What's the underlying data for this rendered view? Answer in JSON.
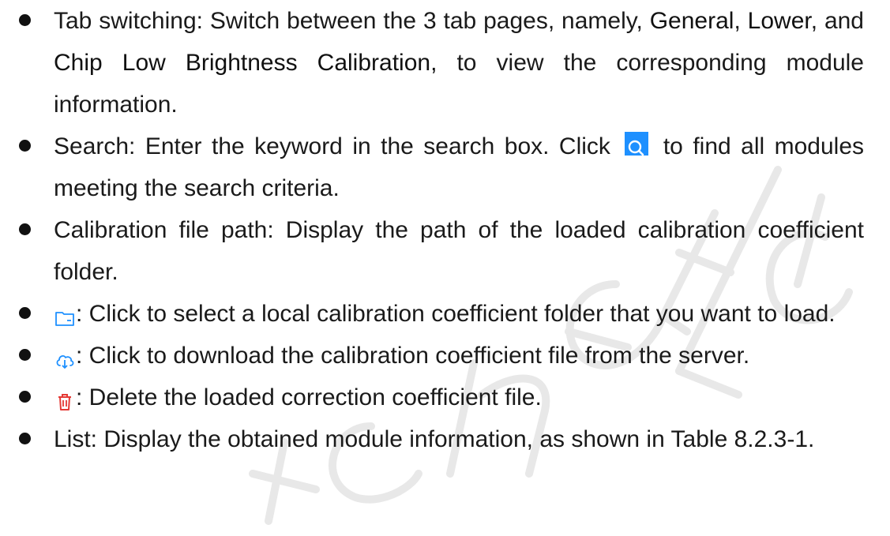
{
  "watermark": {
    "text": "Ltd Tech Ltd",
    "color": "#e6e6e6"
  },
  "accent_color": "#1e90ff",
  "delete_color": "#e53935",
  "items": [
    {
      "name": "tab-switching",
      "pre": "Tab switching: Switch between the 3 tab pages, namely, ",
      "tab1": "General",
      "sep1": ", ",
      "tab2": "Lower",
      "sep2": ", and ",
      "tab3": "Chip Low Brightness Calibration,",
      "post": " to view the corresponding module information."
    },
    {
      "name": "search",
      "pre": "Search: Enter the keyword in the search box. Click",
      "icon": "search-icon",
      "post": " to find all modules meeting the search criteria."
    },
    {
      "name": "calibration-file-path",
      "text": "Calibration file path: Display the path of the loaded calibration coefficient folder."
    },
    {
      "name": "select-folder",
      "icon": "folder-icon",
      "text": ": Click to select a local calibration coefficient folder that you want to load."
    },
    {
      "name": "download",
      "icon": "cloud-download-icon",
      "text": ": Click to download the calibration coefficient file from the server."
    },
    {
      "name": "delete",
      "icon": "trash-icon",
      "text": ": Delete the loaded correction coefficient file."
    },
    {
      "name": "list",
      "text": "List: Display the obtained module information, as shown in Table 8.2.3-1."
    }
  ]
}
